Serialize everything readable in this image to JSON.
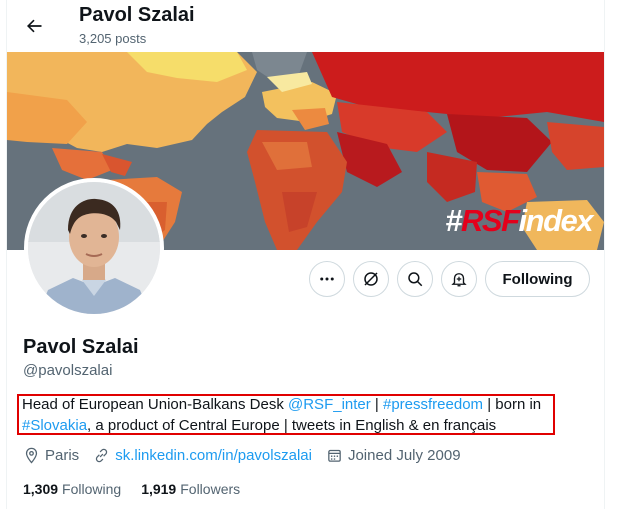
{
  "header": {
    "name": "Pavol Szalai",
    "posts": "3,205 posts"
  },
  "banner": {
    "tag_hash": "#",
    "tag_rsf": "RSF",
    "tag_index": "index"
  },
  "actions": {
    "follow_label": "Following"
  },
  "profile": {
    "name": "Pavol Szalai",
    "handle": "@pavolszalai"
  },
  "bio": {
    "part1": "Head of European Union-Balkans Desk ",
    "mention": "@RSF_inter",
    "sep1": " | ",
    "hashtag1": "#pressfreedom",
    "part2": " | born in ",
    "hashtag2": "#Slovakia",
    "part3": ", a product of Central Europe | tweets in English & en français"
  },
  "meta": {
    "location": "Paris",
    "link": "sk.linkedin.com/in/pavolszalai",
    "joined": "Joined July 2009"
  },
  "stats": {
    "following_count": "1,309",
    "following_label": "Following",
    "followers_count": "1,919",
    "followers_label": "Followers"
  },
  "colors": {
    "accent": "#1d9bf0",
    "highlight": "#e00000",
    "rsf_red": "#e3001b"
  }
}
